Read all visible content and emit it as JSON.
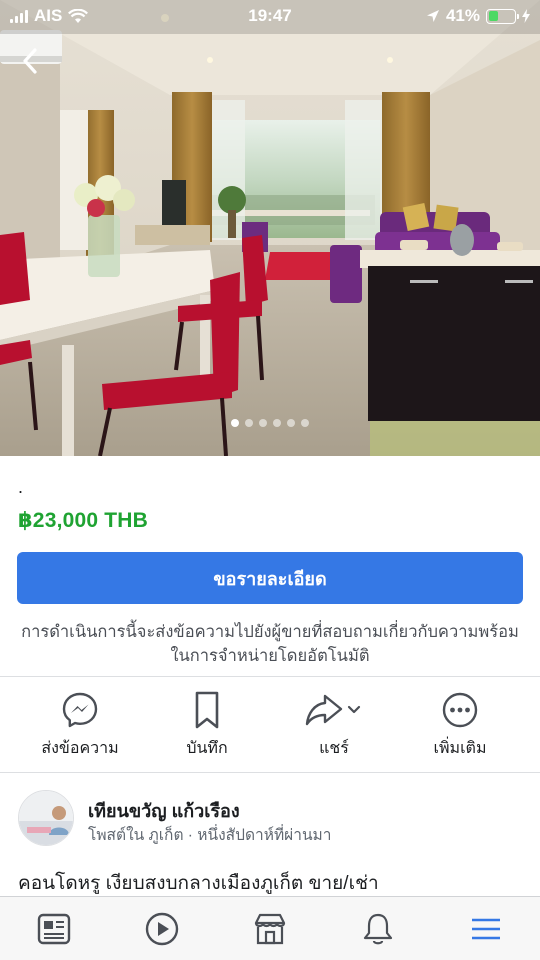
{
  "status_bar": {
    "carrier": "AIS",
    "time": "19:47",
    "battery_text": "41%",
    "battery_level": 0.41,
    "battery_color": "#4cd964"
  },
  "nav": {
    "back_icon": "chevron-left-icon"
  },
  "gallery": {
    "photo_count": 6,
    "active_index": 0
  },
  "listing": {
    "title": ".",
    "price": "฿23,000 THB",
    "price_color": "#1fa332",
    "cta_label": "ขอรายละเอียด",
    "cta_color": "#3578e5",
    "note": "การดำเนินการนี้จะส่งข้อความไปยังผู้ขายที่สอบถามเกี่ยวกับความพร้อมในการจำหน่ายโดยอัตโนมัติ"
  },
  "actions": [
    {
      "label": "ส่งข้อความ",
      "icon": "messenger-icon"
    },
    {
      "label": "บันทึก",
      "icon": "bookmark-icon"
    },
    {
      "label": "แชร์",
      "icon": "share-icon"
    },
    {
      "label": "เพิ่มเติม",
      "icon": "more-icon"
    }
  ],
  "seller": {
    "name": "เทียนขวัญ แก้วเรือง",
    "meta": "โพสต์ใน ภูเก็ต · หนึ่งสัปดาห์ที่ผ่านมา"
  },
  "description": "คอนโดหรู เงียบสงบกลางเมืองภูเก็ต ขาย/เช่า",
  "tab_bar": {
    "tabs": [
      {
        "icon": "news-feed-icon"
      },
      {
        "icon": "video-icon"
      },
      {
        "icon": "marketplace-icon"
      },
      {
        "icon": "notifications-icon"
      },
      {
        "icon": "menu-icon"
      }
    ],
    "active_color": "#3578e5"
  }
}
